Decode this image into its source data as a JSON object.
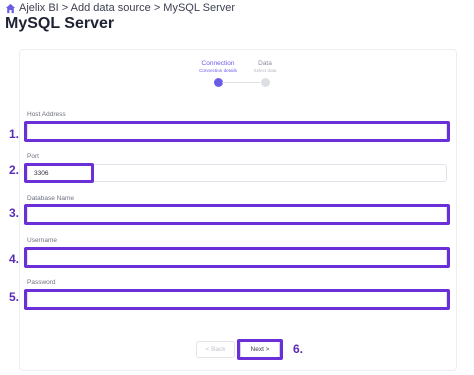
{
  "breadcrumb": {
    "text": "Ajelix BI > Add data source > MySQL Server",
    "icon": "home-icon"
  },
  "page_title": "MySQL Server",
  "stepper": [
    {
      "label": "Connection",
      "sub": "Connection details",
      "state": "active"
    },
    {
      "label": "Data",
      "sub": "Select data",
      "state": "inactive"
    }
  ],
  "form": {
    "host": {
      "label": "Host Address",
      "value": "",
      "marker": "1."
    },
    "port": {
      "label": "Port",
      "value": "3306",
      "marker": "2."
    },
    "database": {
      "label": "Database Name",
      "value": "",
      "marker": "3."
    },
    "username": {
      "label": "Username",
      "value": "",
      "marker": "4."
    },
    "password": {
      "label": "Password",
      "value": "",
      "marker": "5."
    }
  },
  "buttons": {
    "back": "< Back",
    "next": "Next >",
    "next_marker": "6."
  },
  "colors": {
    "accent": "#6b5ce7",
    "highlight": "#6a2fd6"
  }
}
